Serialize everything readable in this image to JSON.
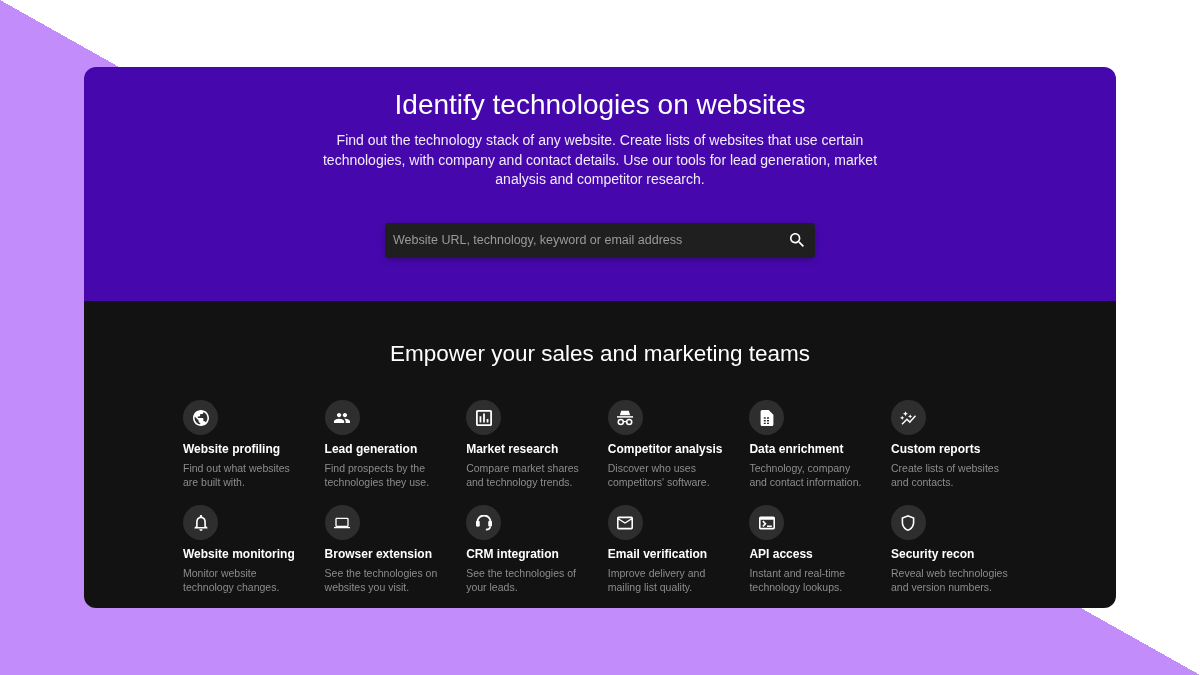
{
  "hero": {
    "title": "Identify technologies on websites",
    "description": "Find out the technology stack of any website. Create lists of websites that use certain technologies, with company and contact details. Use our tools for lead generation, market analysis and competitor research.",
    "search": {
      "placeholder": "Website URL, technology, keyword or email address"
    }
  },
  "features": {
    "heading": "Empower your sales and marketing teams",
    "items": [
      {
        "kind": "globe",
        "title": "Website profiling",
        "description": "Find out what websites are built with."
      },
      {
        "kind": "people",
        "title": "Lead generation",
        "description": "Find prospects by the technologies they use."
      },
      {
        "kind": "chart",
        "title": "Market research",
        "description": "Compare market shares and technology trends."
      },
      {
        "kind": "incognito",
        "title": "Competitor analysis",
        "description": "Discover who uses competitors' software."
      },
      {
        "kind": "sheet",
        "title": "Data enrichment",
        "description": "Technology, company and contact information."
      },
      {
        "kind": "trend",
        "title": "Custom reports",
        "description": "Create lists of websites and contacts."
      },
      {
        "kind": "bell",
        "title": "Website monitoring",
        "description": "Monitor website technology changes."
      },
      {
        "kind": "laptop",
        "title": "Browser extension",
        "description": "See the technologies on websites you visit."
      },
      {
        "kind": "headset",
        "title": "CRM integration",
        "description": "See the technologies of your leads."
      },
      {
        "kind": "mail",
        "title": "Email verification",
        "description": "Improve delivery and mailing list quality."
      },
      {
        "kind": "terminal",
        "title": "API access",
        "description": "Instant and real-time technology lookups."
      },
      {
        "kind": "shield",
        "title": "Security recon",
        "description": "Reveal web technologies and version numbers."
      }
    ]
  }
}
